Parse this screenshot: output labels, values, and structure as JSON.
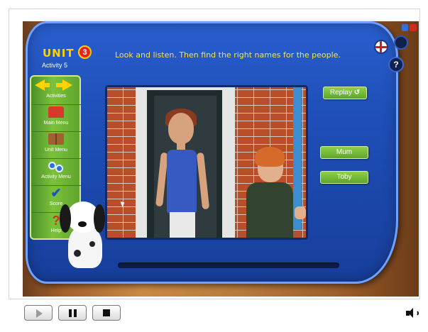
{
  "header": {
    "unit_label": "UNIT",
    "unit_number": "3",
    "activity": "Activity 5",
    "instruction": "Look and listen. Then find the right names for the people."
  },
  "sidebar": {
    "items": [
      {
        "label": "Activities",
        "icon": "arrows-icon"
      },
      {
        "label": "Main Menu",
        "icon": "house-icon"
      },
      {
        "label": "Unit Menu",
        "icon": "book-icon"
      },
      {
        "label": "Activity Menu",
        "icon": "gears-icon"
      },
      {
        "label": "Score",
        "icon": "check-icon"
      },
      {
        "label": "Help",
        "icon": "question-icon"
      }
    ]
  },
  "buttons": {
    "replay": "Replay",
    "replay_symbol": "↺",
    "name_1": "Mum",
    "name_2": "Toby",
    "help_mini": "?"
  },
  "player": {
    "play": "play-icon",
    "pause": "pause-icon",
    "stop": "stop-icon",
    "volume": "speaker-icon"
  },
  "colors": {
    "panel_blue": "#1f4fb8",
    "accent_yellow": "#ffd200",
    "sidebar_green": "#7bc23a",
    "unit_badge_red": "#e8231e"
  }
}
